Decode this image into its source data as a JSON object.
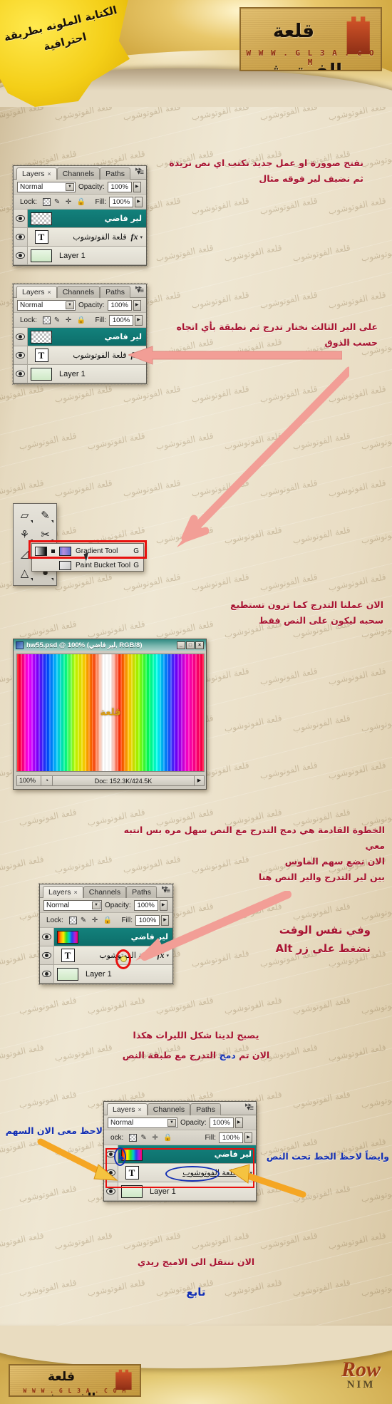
{
  "header": {
    "note_text": "الكتابة الملونه\nبطريقة احترافية",
    "logo_arabic": "قلعة الفوتوشوب",
    "logo_url": "W W W . G L 3 A . C O M"
  },
  "annotations": {
    "step1": "نفتح  صوورة او عمل جديد نكتب اي نص نريدة\nثم نضيف لير فوقه  مثال",
    "step2": "على الير الثالث نختار تدرج ثم نطبقة بأي اتجاه\nحسب الذوق",
    "step3": "الان  عملنا التدرج  كما ترون تستطيع\nسحبه ليكون  على النص فقط",
    "step4": "الخطوة القادمة  هي دمج  التدرج  مع  النص سهل مره  بس انتبه معي\nالان نضع  سهم الماوس\nبين لير التدرج  والير النص هنا",
    "step4_big": "وفي نفس الوقت\nنضغط على زر  Alt",
    "step5_line1": "يصبح  لدينا  شكل الليرات هكذا",
    "step5_line2_red": "الان  تم ",
    "step5_line2_blue": "دمج",
    "step5_line2_red2": " التدرج مع طبقة النص",
    "note_arrow": "لاحظ معى الان  السهم",
    "note_underline": "وايضاً لاحظ الخط تحت النص",
    "closing": "الان  ننتقل الى الاميج ريدي",
    "continue": "تابع"
  },
  "layers_panel": {
    "tabs": [
      {
        "label": "Layers",
        "has_close": true,
        "active": true
      },
      {
        "label": "Channels",
        "has_close": false,
        "active": false
      },
      {
        "label": "Paths",
        "has_close": false,
        "active": false
      }
    ],
    "blend_mode": "Normal",
    "opacity_label": "Opacity:",
    "opacity_value": "100%",
    "lock_label": "Lock:",
    "fill_label": "Fill:",
    "fill_value": "100%",
    "lock_icons": [
      "lock-transparent-pixels-icon",
      "lock-image-pixels-icon",
      "lock-position-icon",
      "lock-all-icon"
    ]
  },
  "panel_a": {
    "layers": [
      {
        "name": "لير فاضي",
        "thumb": "checker",
        "selected": true,
        "fx": false,
        "rtl": true
      },
      {
        "name": "قلعة الفوتوشوب",
        "thumb": "text",
        "selected": false,
        "fx": true,
        "rtl": true
      },
      {
        "name": "Layer 1",
        "thumb": "green",
        "selected": false,
        "fx": false,
        "rtl": false
      }
    ]
  },
  "panel_b": {
    "layers": [
      {
        "name": "لير فاضي",
        "thumb": "checker",
        "selected": true,
        "fx": false,
        "rtl": true
      },
      {
        "name": "قلعة الفوتوشوب",
        "thumb": "text",
        "selected": false,
        "fx": true,
        "rtl": true
      },
      {
        "name": "Layer 1",
        "thumb": "green",
        "selected": false,
        "fx": false,
        "rtl": false
      }
    ]
  },
  "panel_c": {
    "layers": [
      {
        "name": "لير فاضي",
        "thumb": "rainbow",
        "selected": true,
        "fx": false,
        "rtl": true
      },
      {
        "name": "قلعة الفوتوشوب",
        "thumb": "text",
        "selected": false,
        "fx": true,
        "rtl": true
      },
      {
        "name": "Layer 1",
        "thumb": "green",
        "selected": false,
        "fx": false,
        "rtl": false
      }
    ]
  },
  "panel_d": {
    "layers": [
      {
        "name": "لير فاضي",
        "thumb": "rainbow",
        "selected": true,
        "fx": false,
        "rtl": true
      },
      {
        "name": "قلعة الفوتوشوب",
        "thumb": "text",
        "selected": false,
        "fx": true,
        "rtl": true
      },
      {
        "name": "Layer 1",
        "thumb": "green",
        "selected": false,
        "fx": false,
        "rtl": false
      }
    ],
    "lock_label_clipped": "ock:"
  },
  "toolbox": {
    "tools": [
      "lasso-tool-icon",
      "brush-tool-icon",
      "healing-brush-tool-icon",
      "clone-stamp-tool-icon",
      "eraser-tool-icon",
      "gradient-tool-icon",
      "dodge-tool-icon",
      "blur-tool-icon",
      "pen-tool-icon",
      "type-tool-icon"
    ]
  },
  "flyout": {
    "items": [
      {
        "label": "Gradient Tool",
        "shortcut": "G",
        "selected": true
      },
      {
        "label": "Paint Bucket Tool",
        "shortcut": "G",
        "selected": false
      }
    ]
  },
  "document_window": {
    "title": "hw55.psd @ 100% (لير فاضي, RGB/8)",
    "window_buttons": [
      "_",
      "□",
      "×"
    ],
    "canvas_text": "قلعة",
    "status_zoom": "100%",
    "status_doc": "Doc: 152.3K/424.5K"
  },
  "footer": {
    "logo_arabic": "قلعة الفوتوشوب",
    "logo_url": "W W W . G L 3 A . C O M",
    "signature_main": "Row",
    "signature_sub": "NIM"
  },
  "colors": {
    "annotation_red": "#a81432",
    "annotation_blue": "#1430b4",
    "selected_layer_teal": "#0d6e6a",
    "highlight_red": "#e8110f",
    "arrow_pink": "#f09a92",
    "arrow_orange": "#f5a623",
    "header_gold": "#d8b04b"
  }
}
